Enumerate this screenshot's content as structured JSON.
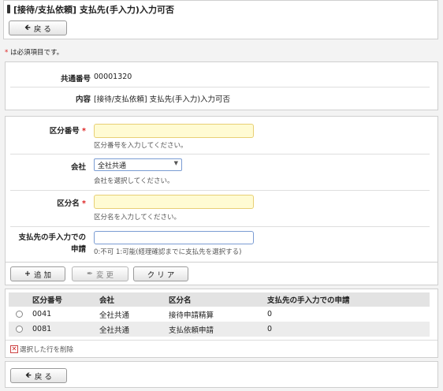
{
  "page": {
    "title": "[接待/支払依頼] 支払先(手入力)入力可否",
    "back_label": "戻 る"
  },
  "required_note": "は必須項目です。",
  "info": {
    "common_no_label": "共通番号",
    "common_no_value": "00001320",
    "content_label": "内容",
    "content_value": "[接待/支払依頼] 支払先(手入力)入力可否"
  },
  "form": {
    "category_no": {
      "label": "区分番号",
      "hint": "区分番号を入力してください。",
      "value": ""
    },
    "company": {
      "label": "会社",
      "value": "全社共通",
      "hint": "会社を選択してください。"
    },
    "category_name": {
      "label": "区分名",
      "hint": "区分名を入力してください。",
      "value": ""
    },
    "manual_entry": {
      "label_line1": "支払先の手入力での",
      "label_line2": "申請",
      "hint": "0:不可 1:可能(経理確認までに支払先を選択する)",
      "value": ""
    },
    "buttons": {
      "add": "追 加",
      "change": "変 更",
      "clear": "ク リ ア"
    }
  },
  "table": {
    "columns": [
      "区分番号",
      "会社",
      "区分名",
      "支払先の手入力での申請"
    ],
    "rows": [
      [
        "0041",
        "全社共通",
        "接待申請精算",
        "0"
      ],
      [
        "0081",
        "全社共通",
        "支払依頼申請",
        "0"
      ]
    ],
    "delete_label": "選択した行を削除"
  },
  "colors": {
    "required": "#dd2222",
    "accent": "#e8cf74"
  }
}
